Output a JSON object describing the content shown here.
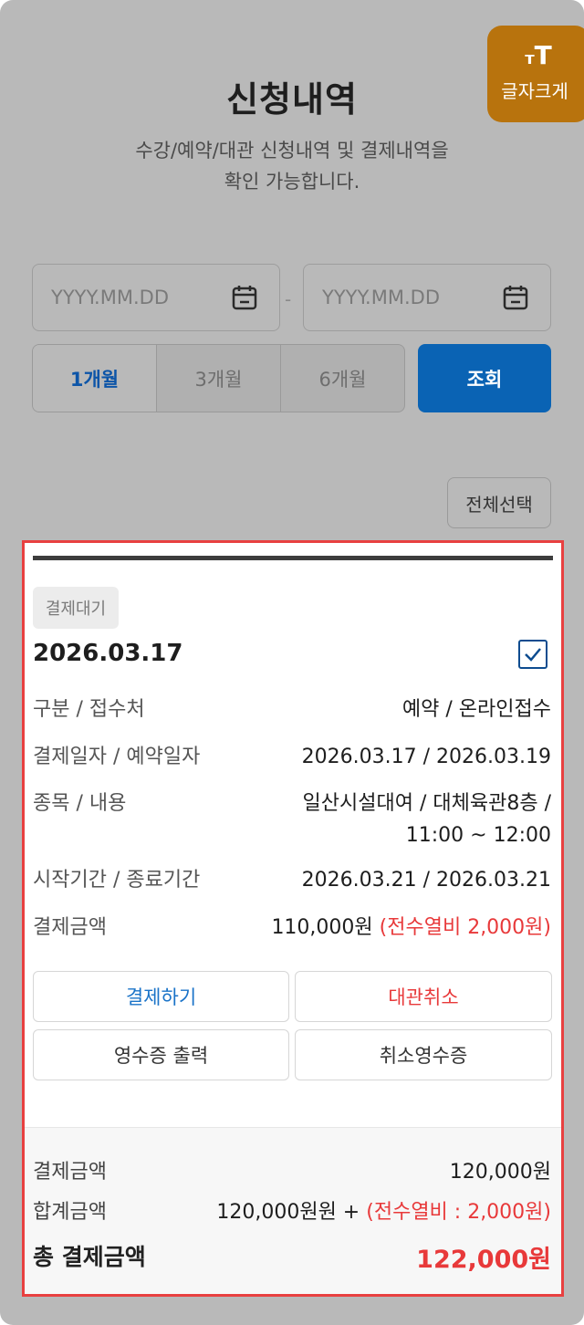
{
  "header": {
    "title": "신청내역",
    "desc_line1": "수강/예약/대관 신청내역 및 결제내역을",
    "desc_line2": "확인 가능합니다.",
    "font_size_button": "글자크게",
    "font_size_icon": "ᴛT"
  },
  "filters": {
    "start_date_placeholder": "YYYY.MM.DD",
    "end_date_placeholder": "YYYY.MM.DD",
    "separator": "-",
    "periods": [
      "1개월",
      "3개월",
      "6개월"
    ],
    "search_label": "조회",
    "select_all_label": "전체선택"
  },
  "card": {
    "status": "결제대기",
    "date": "2026.03.17",
    "checked": true,
    "rows": [
      {
        "label": "구분 / 접수처",
        "value": "예약 / 온라인접수"
      },
      {
        "label": "결제일자 / 예약일자",
        "value": "2026.03.17 / 2026.03.19"
      },
      {
        "label": "종목 / 내용",
        "value_line1": "일산시설대여 / 대체육관8층 /",
        "value_line2": "11:00 ~ 12:00"
      },
      {
        "label": "시작기간 / 종료기간",
        "value": "2026.03.21 / 2026.03.21"
      },
      {
        "label": "결제금액",
        "value": "110,000원",
        "value_extra": "(전수열비 2,000원)"
      }
    ],
    "actions": {
      "pay": "결제하기",
      "cancel": "대관취소",
      "receipt": "영수증 출력",
      "cancel_receipt": "취소영수증"
    }
  },
  "summary": {
    "payment_label": "결제금액",
    "payment_value": "120,000원",
    "sum_label": "합계금액",
    "sum_value": "120,000원원 +",
    "sum_extra": "(전수열비 : 2,000원)",
    "total_label": "총 결제금액",
    "total_value": "122,000원"
  },
  "colors": {
    "accent_blue": "#0a63b4",
    "highlight_red": "#e84040",
    "font_button_orange": "#b8730d"
  }
}
